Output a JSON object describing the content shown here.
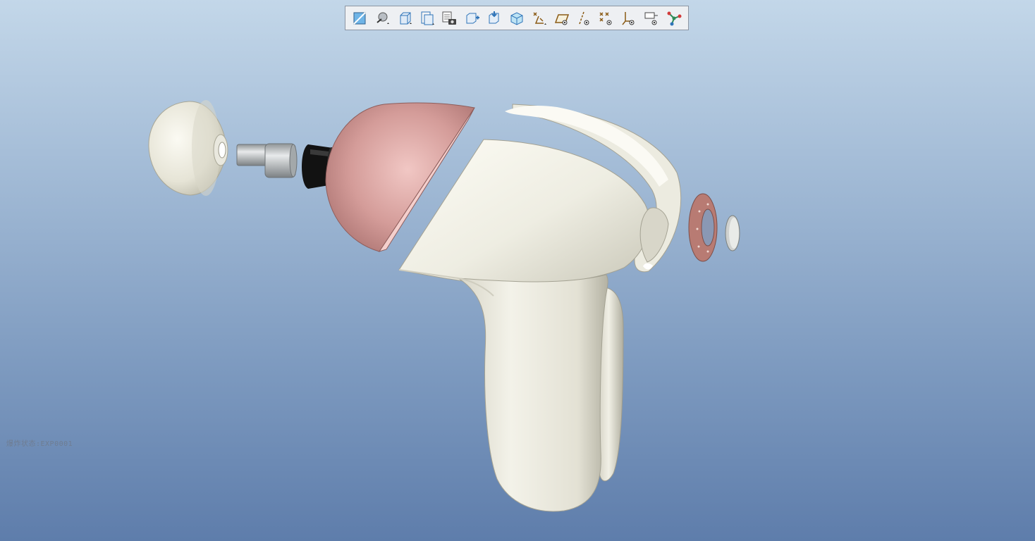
{
  "toolbar": {
    "buttons": [
      {
        "name": "refit-icon"
      },
      {
        "name": "display-style-icon"
      },
      {
        "name": "saved-views-icon"
      },
      {
        "name": "view-manager-icon"
      },
      {
        "name": "appearance-gallery-icon"
      },
      {
        "name": "zoom-in-icon"
      },
      {
        "name": "zoom-out-icon"
      },
      {
        "name": "perspective-view-icon"
      },
      {
        "name": "datum-display-filters-icon"
      },
      {
        "name": "plane-display-icon"
      },
      {
        "name": "axis-display-icon"
      },
      {
        "name": "point-display-icon"
      },
      {
        "name": "csys-display-icon"
      },
      {
        "name": "annotation-display-icon"
      },
      {
        "name": "spin-center-icon"
      }
    ]
  },
  "model": {
    "explode_state_label": "爆炸状态:EXP0001"
  },
  "colors": {
    "background_top": "#c3d7e9",
    "background_bottom": "#5e7dab",
    "ivory_part": "#efeee4",
    "pink_part": "#d29a98",
    "metal_part": "#c9cdd0",
    "rubber_part": "#111111",
    "copper_part": "#b77a72"
  }
}
